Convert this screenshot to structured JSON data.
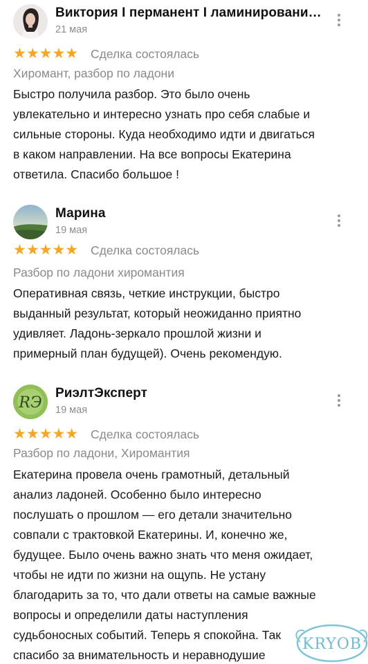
{
  "reviews": [
    {
      "name": "Виктория I перманент I ламинировани…",
      "date": "21 мая",
      "stars": "★★★★★",
      "deal_status": "Сделка состоялась",
      "service": "Хиромант, разбор по ладони",
      "text_lines": [
        "Быстро получила разбор. Это было очень",
        "увлекательно и интересно узнать про себя слабые и",
        "сильные стороны. Куда необходимо идти и двигаться",
        "в каком направлении. На все вопросы Екатерина",
        "ответила. Спасибо большое !"
      ],
      "avatar_icon": "woman-portrait-icon"
    },
    {
      "name": "Марина",
      "date": "19 мая",
      "stars": "★★★★★",
      "deal_status": "Сделка состоялась",
      "service": "Разбор по ладони хиромантия",
      "text_lines": [
        "Оперативная связь, четкие инструкции, быстро",
        "выданный результат, который неожиданно приятно",
        "удивляет.  Ладонь-зеркало прошлой жизни и",
        "примерный план будущей). Очень рекомендую."
      ],
      "avatar_icon": "landscape-icon"
    },
    {
      "name": "РиэлтЭксперт",
      "date": "19 мая",
      "stars": "★★★★★",
      "deal_status": "Сделка состоялась",
      "service": "Разбор по ладони, Хиромантия",
      "text_lines": [
        "Екатерина провела очень грамотный, детальный",
        "анализ ладоней. Особенно было интересно",
        "послушать о прошлом — его детали значительно",
        "совпали с трактовкой Екатерины. И, конечно же,",
        "будущее. Было очень важно знать что меня ожидает,",
        "чтобы не идти по жизни на ощупь. Не устану",
        "благодарить за то, что дали ответы на самые важные",
        "вопросы и определили даты наступления",
        "судьбоносных событий. Теперь я спокойна. Так",
        "спасибо за внимательность и неравнодушие"
      ],
      "avatar_icon": "monogram-logo-icon",
      "avatar_text": "RЭ"
    }
  ],
  "rating_value": 5,
  "watermark": {
    "text": "KRYOB"
  },
  "colors": {
    "star": "#f5a623",
    "muted": "#8a8a8a",
    "text": "#1a1a1a"
  }
}
